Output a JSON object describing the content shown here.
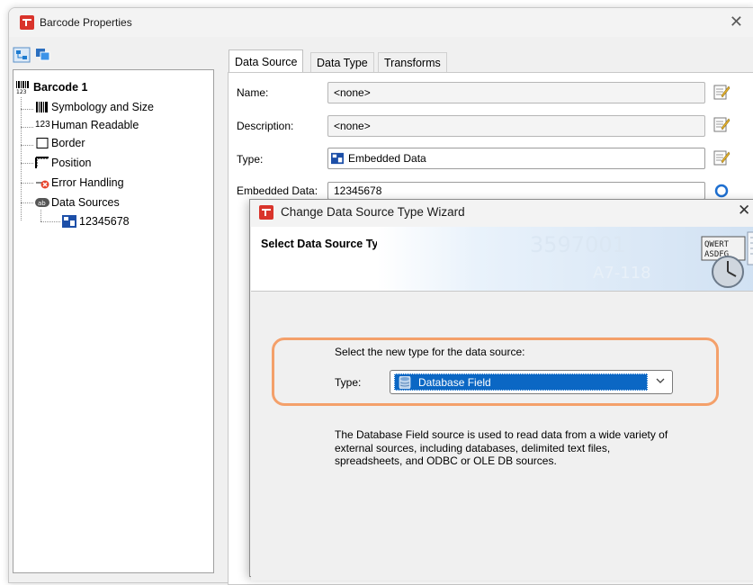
{
  "window": {
    "title": "Barcode Properties",
    "close_glyph": "✕",
    "accent": "#d9342b"
  },
  "tree": {
    "toolbar": [
      {
        "icon": "expand-tree-icon"
      },
      {
        "icon": "layers-icon"
      }
    ],
    "items": [
      {
        "label": "Barcode 1",
        "icon": "barcode-123-icon",
        "bold": true
      },
      {
        "label": "Symbology and Size",
        "icon": "barcode-icon"
      },
      {
        "label": "Human Readable",
        "icon": "text-123-icon",
        "prefix": "123"
      },
      {
        "label": "Border",
        "icon": "border-icon"
      },
      {
        "label": "Position",
        "icon": "position-icon"
      },
      {
        "label": "Error Handling",
        "icon": "error-icon"
      },
      {
        "label": "Data Sources",
        "icon": "data-sources-icon"
      },
      {
        "label": "12345678",
        "icon": "embedded-data-icon",
        "selected": true
      }
    ]
  },
  "tabs": [
    {
      "label": "Data Source",
      "active": true
    },
    {
      "label": "Data Type",
      "active": false
    },
    {
      "label": "Transforms",
      "active": false
    }
  ],
  "fields": {
    "name": {
      "label": "Name:",
      "value": "<none>"
    },
    "description": {
      "label": "Description:",
      "value": "<none>"
    },
    "type": {
      "label": "Type:",
      "value": "Embedded Data"
    },
    "embedded": {
      "label": "Embedded Data:",
      "value": "12345678"
    }
  },
  "wizard": {
    "title": "Change Data Source Type Wizard",
    "close_glyph": "✕",
    "header_title": "Select Data Source Type",
    "banner_text": "3597001",
    "banner_text2": "A7-118",
    "keys_row1": "QWERT",
    "keys_row2": "ASDFG",
    "prompt": "Select the new type for the data source:",
    "type_label": "Type:",
    "type_value": "Database Field",
    "description": "The Database Field source is used to read data from a wide variety of external sources, including databases, delimited text files, spreadsheets, and ODBC or OLE DB sources.",
    "highlight_color": "#f4a06a",
    "selection_color": "#0b67c4"
  }
}
